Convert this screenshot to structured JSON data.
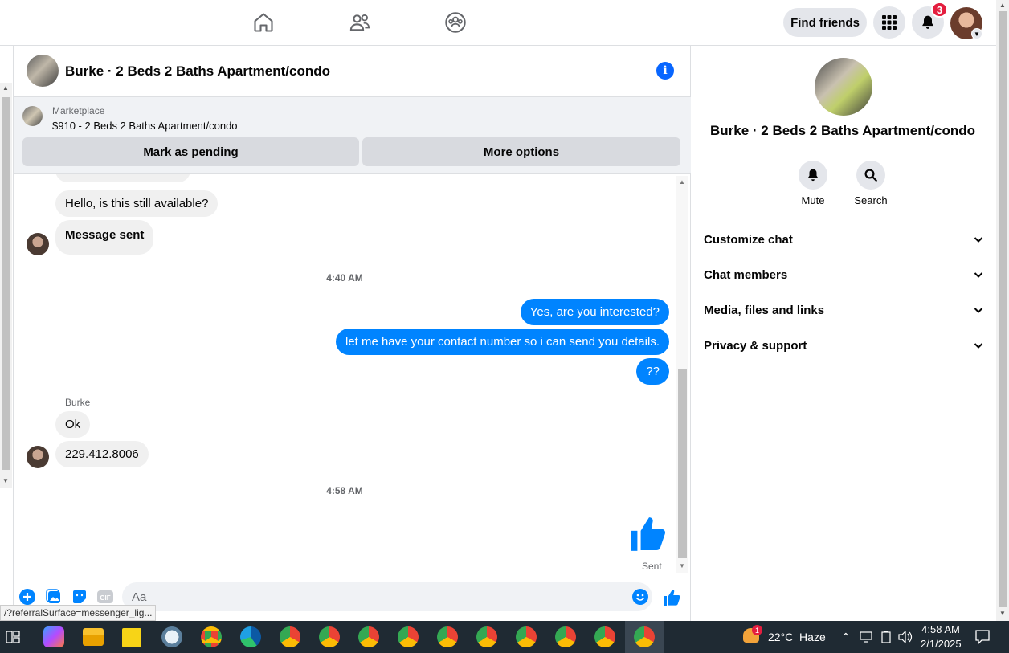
{
  "topbar": {
    "find_friends_label": "Find friends",
    "notification_count": "3"
  },
  "chat": {
    "title": "Burke · 2 Beds 2 Baths Apartment/condo",
    "marketplace_label": "Marketplace",
    "listing": "$910 - 2 Beds 2 Baths Apartment/condo",
    "mark_pending_label": "Mark as pending",
    "more_options_label": "More options",
    "messages": {
      "in1": "Hello, is this still available?",
      "in2": "Message sent",
      "time1": "4:40 AM",
      "out1": "Yes, are you interested?",
      "out2": "let me have your contact number so i can send you details.",
      "out3": "??",
      "sender": "Burke",
      "in3": "Ok",
      "in4": "229.412.8006",
      "time2": "4:58 AM",
      "sent_status": "Sent"
    },
    "composer_placeholder": "Aa"
  },
  "status_url": "/?referralSurface=messenger_lig...",
  "right_panel": {
    "title": "Burke · 2 Beds 2 Baths Apartment/condo",
    "mute_label": "Mute",
    "search_label": "Search",
    "sections": [
      "Customize chat",
      "Chat members",
      "Media, files and links",
      "Privacy & support"
    ]
  },
  "taskbar": {
    "weather": "22°C  Haze",
    "weather_badge": "1",
    "time": "4:58 AM",
    "date": "2/1/2025"
  },
  "colors": {
    "accent": "#0084ff",
    "badge": "#e41e3f"
  }
}
